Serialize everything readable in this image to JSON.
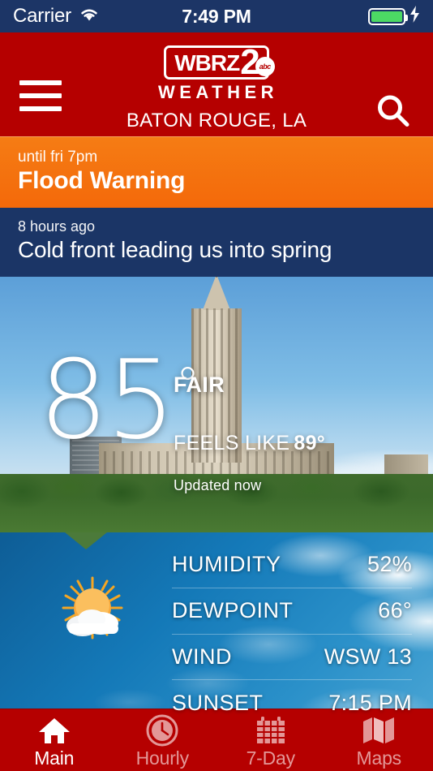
{
  "statusbar": {
    "carrier": "Carrier",
    "wifi_icon": "wifi-icon",
    "time": "7:49 PM",
    "battery_icon": "battery-full-icon",
    "charging_icon": "lightning-bolt-icon"
  },
  "header": {
    "menu_icon": "hamburger-menu-icon",
    "search_icon": "search-icon",
    "logo": {
      "call_sign": "WBRZ",
      "channel": "2",
      "network": "abc",
      "sub": "WEATHER"
    },
    "location": "BATON ROUGE, LA",
    "background_color": "#b50000"
  },
  "alert": {
    "subtitle": "until fri 7pm",
    "title": "Flood Warning",
    "background_color": "#f57c14"
  },
  "news": {
    "subtitle": "8 hours ago",
    "title": "Cold front leading us into spring",
    "background_color": "#1b3566"
  },
  "current": {
    "temperature": "85",
    "degree": "°",
    "condition": "FAIR",
    "feels_like_label": "FEELS LIKE",
    "feels_like_value": "89°",
    "updated": "Updated now",
    "weather_icon": "sun-behind-cloud-icon"
  },
  "details": {
    "rows": [
      {
        "label": "HUMIDITY",
        "value": "52%"
      },
      {
        "label": "DEWPOINT",
        "value": "66°"
      },
      {
        "label": "WIND",
        "value": "WSW 13"
      },
      {
        "label": "SUNSET",
        "value": "7:15 PM"
      }
    ]
  },
  "tabbar": {
    "tabs": [
      {
        "label": "Main",
        "icon": "home-icon",
        "active": true
      },
      {
        "label": "Hourly",
        "icon": "clock-icon",
        "active": false
      },
      {
        "label": "7-Day",
        "icon": "calendar-icon",
        "active": false
      },
      {
        "label": "Maps",
        "icon": "map-icon",
        "active": false
      }
    ]
  }
}
